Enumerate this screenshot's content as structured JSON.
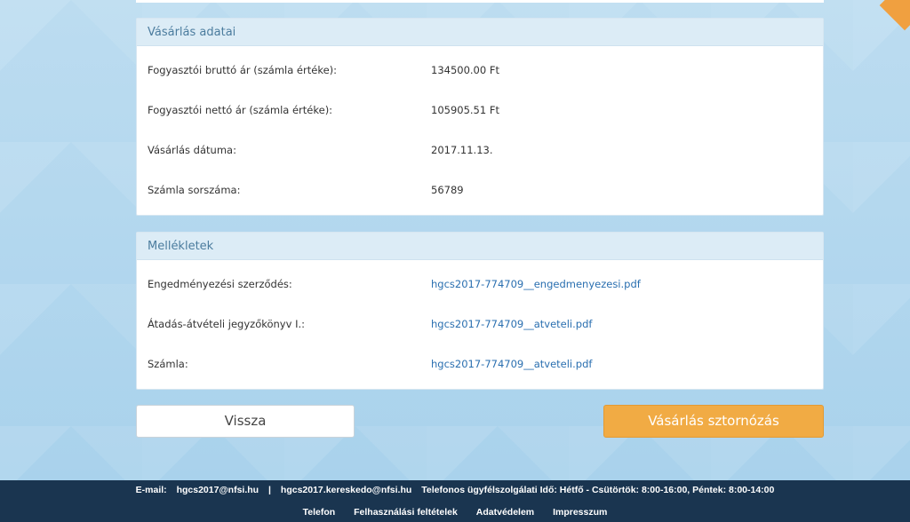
{
  "purchase": {
    "title": "Vásárlás adatai",
    "rows": [
      {
        "label": "Fogyasztói bruttó ár (számla értéke):",
        "value": "134500.00 Ft"
      },
      {
        "label": "Fogyasztói nettó ár (számla értéke):",
        "value": "105905.51 Ft"
      },
      {
        "label": "Vásárlás dátuma:",
        "value": "2017.11.13."
      },
      {
        "label": "Számla sorszáma:",
        "value": "56789"
      }
    ]
  },
  "attachments": {
    "title": "Mellékletek",
    "rows": [
      {
        "label": "Engedményezési szerződés:",
        "value": "hgcs2017-774709__engedmenyezesi.pdf"
      },
      {
        "label": "Átadás-átvételi jegyzőkönyv I.:",
        "value": "hgcs2017-774709__atveteli.pdf"
      },
      {
        "label": "Számla:",
        "value": "hgcs2017-774709__atveteli.pdf"
      }
    ]
  },
  "buttons": {
    "back": "Vissza",
    "cancel_purchase": "Vásárlás sztornózás"
  },
  "footer": {
    "email_label": "E-mail:",
    "email1": "hgcs2017@nfsi.hu",
    "separator": "|",
    "email2": "hgcs2017.kereskedo@nfsi.hu",
    "hours": "Telefonos ügyfélszolgálati Idő: Hétfő - Csütörtök: 8:00-16:00, Péntek: 8:00-14:00",
    "links": [
      "Telefon",
      "Felhasználási feltételek",
      "Adatvédelem",
      "Impresszum"
    ]
  },
  "colors": {
    "accent_orange": "#f1ab44",
    "link_blue": "#2a6fb0",
    "footer_bg": "#1a3550",
    "panel_header_bg": "#dcecf6"
  }
}
